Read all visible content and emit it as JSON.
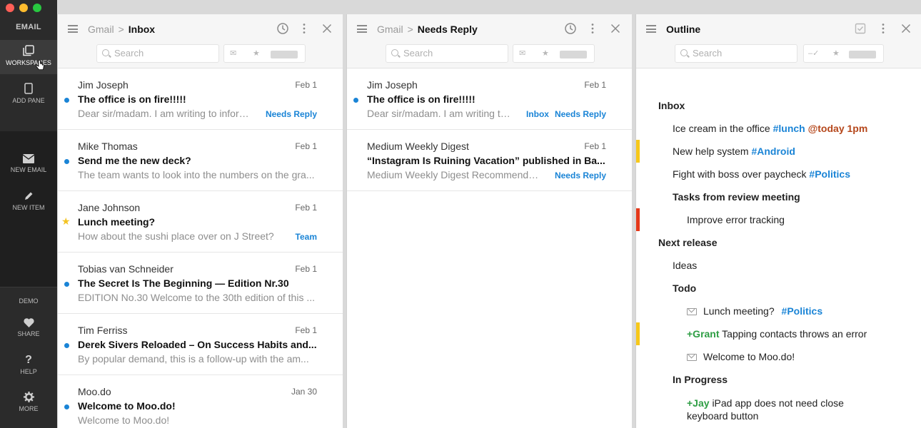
{
  "sidebar": {
    "title": "EMAIL",
    "items": [
      {
        "label": "WORKSPACES",
        "icon": "workspaces-icon"
      },
      {
        "label": "ADD PANE",
        "icon": "add-pane-icon"
      },
      {
        "label": "NEW EMAIL",
        "icon": "envelope-icon"
      },
      {
        "label": "NEW ITEM",
        "icon": "pencil-icon"
      },
      {
        "label": "DEMO",
        "icon": ""
      },
      {
        "label": "SHARE",
        "icon": "heart-icon"
      },
      {
        "label": "HELP",
        "icon": "question-icon"
      },
      {
        "label": "MORE",
        "icon": "gear-icon"
      }
    ],
    "traffic_colors": [
      "#ff5f57",
      "#febc2e",
      "#28c840"
    ]
  },
  "panes": {
    "inbox": {
      "source": "Gmail",
      "separator": ">",
      "folder": "Inbox",
      "search_placeholder": "Search",
      "emails": [
        {
          "from": "Jim Joseph",
          "date": "Feb 1",
          "subject": "The office is on fire!!!!!",
          "preview": "Dear sir/madam. I am writing to inform ...",
          "tags": [
            "Needs Reply"
          ],
          "marker": "dot"
        },
        {
          "from": "Mike Thomas",
          "date": "Feb 1",
          "subject": "Send me the new deck?",
          "preview": "The team wants to look into the numbers on the gra...",
          "tags": [],
          "marker": "dot"
        },
        {
          "from": "Jane Johnson",
          "date": "Feb 1",
          "subject": "Lunch meeting?",
          "preview": "How about the sushi place over on J Street?",
          "tags": [
            "Team"
          ],
          "marker": "star"
        },
        {
          "from": "Tobias van Schneider",
          "date": "Feb 1",
          "subject": "The Secret Is The Beginning  — Edition Nr.30",
          "preview": "EDITION No.30 Welcome to the 30th edition of this ...",
          "tags": [],
          "marker": "dot"
        },
        {
          "from": "Tim Ferriss",
          "date": "Feb 1",
          "subject": "Derek Sivers Reloaded – On Success Habits and...",
          "preview": "By popular demand, this is a follow-up with the am...",
          "tags": [],
          "marker": "dot"
        },
        {
          "from": "Moo.do",
          "date": "Jan 30",
          "subject": "Welcome to Moo.do!",
          "preview": "Welcome to Moo.do!",
          "tags": [],
          "marker": "dot"
        }
      ]
    },
    "needs_reply": {
      "source": "Gmail",
      "separator": ">",
      "folder": "Needs Reply",
      "search_placeholder": "Search",
      "emails": [
        {
          "from": "Jim Joseph",
          "date": "Feb 1",
          "subject": "The office is on fire!!!!!",
          "preview": "Dear sir/madam. I am writing to i...",
          "tags": [
            "Inbox",
            "Needs Reply"
          ],
          "marker": "dot"
        },
        {
          "from": "Medium Weekly Digest",
          "date": "Feb 1",
          "subject": "“Instagram Is Ruining Vacation” published in Ba...",
          "preview": "Medium Weekly Digest Recommended ...",
          "tags": [
            "Needs Reply"
          ],
          "marker": "none"
        }
      ]
    },
    "outline": {
      "title": "Outline",
      "search_placeholder": "Search",
      "items": {
        "inbox": "Inbox",
        "ice_cream": "Ice cream in the office",
        "ice_tag1": "#lunch",
        "ice_tag2": "@today 1pm",
        "help_system": "New help system",
        "help_tag": "#Android",
        "fight": "Fight with boss over paycheck",
        "fight_tag": "#Politics",
        "tasks": "Tasks from review meeting",
        "improve": "Improve error tracking",
        "next_release": "Next release",
        "ideas": "Ideas",
        "todo": "Todo",
        "lunch": "Lunch meeting?",
        "lunch_tag": "#Politics",
        "grant": "+Grant",
        "grant_text": "Tapping contacts throws an error",
        "welcome": "Welcome to Moo.do!",
        "in_progress": "In Progress",
        "jay": "+Jay",
        "jay_text_1": "iPad app does not need close",
        "jay_text_2": "keyboard button"
      },
      "marker_colors": {
        "yellow": "#f7c81a",
        "red": "#e5391b"
      }
    }
  }
}
